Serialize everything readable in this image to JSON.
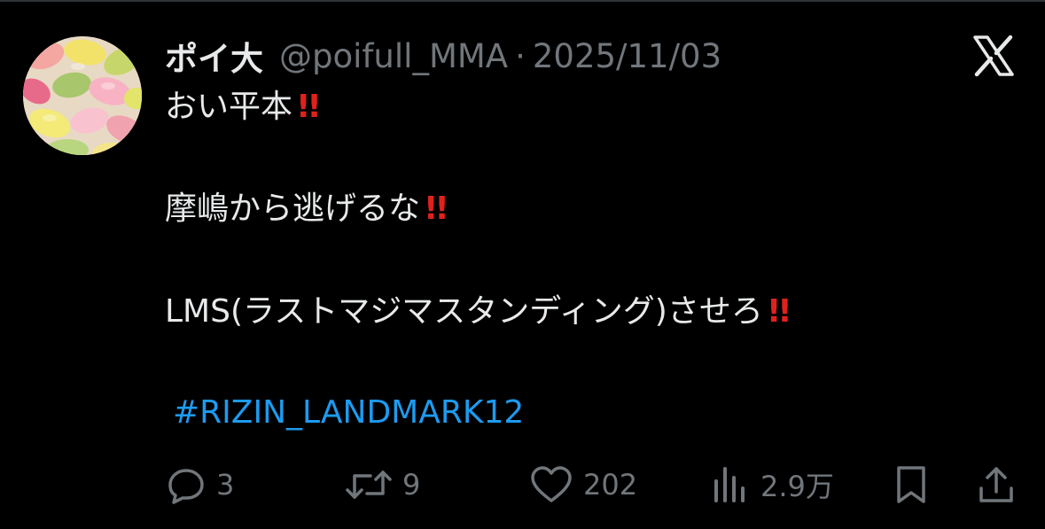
{
  "tweet": {
    "display_name": "ポイ大",
    "handle": "@poifull_MMA",
    "separator": "·",
    "date": "2025/11/03",
    "lines": [
      "おい平本",
      "摩嶋から逃げるな",
      "LMS(ラストマジマスタンディング)させろ"
    ],
    "emphasis": "!!",
    "hashtag": "#RIZIN_LANDMARK12"
  },
  "actions": {
    "reply": {
      "icon": "reply-icon",
      "count": "3"
    },
    "retweet": {
      "icon": "retweet-icon",
      "count": "9"
    },
    "like": {
      "icon": "heart-icon",
      "count": "202"
    },
    "views": {
      "icon": "views-icon",
      "count": "2.9万"
    },
    "bookmark": {
      "icon": "bookmark-icon"
    },
    "share": {
      "icon": "share-icon"
    }
  },
  "colors": {
    "background": "#000000",
    "text": "#e7e9ea",
    "muted": "#71767b",
    "link": "#1d9bf0",
    "emphasis": "#e0211c"
  }
}
